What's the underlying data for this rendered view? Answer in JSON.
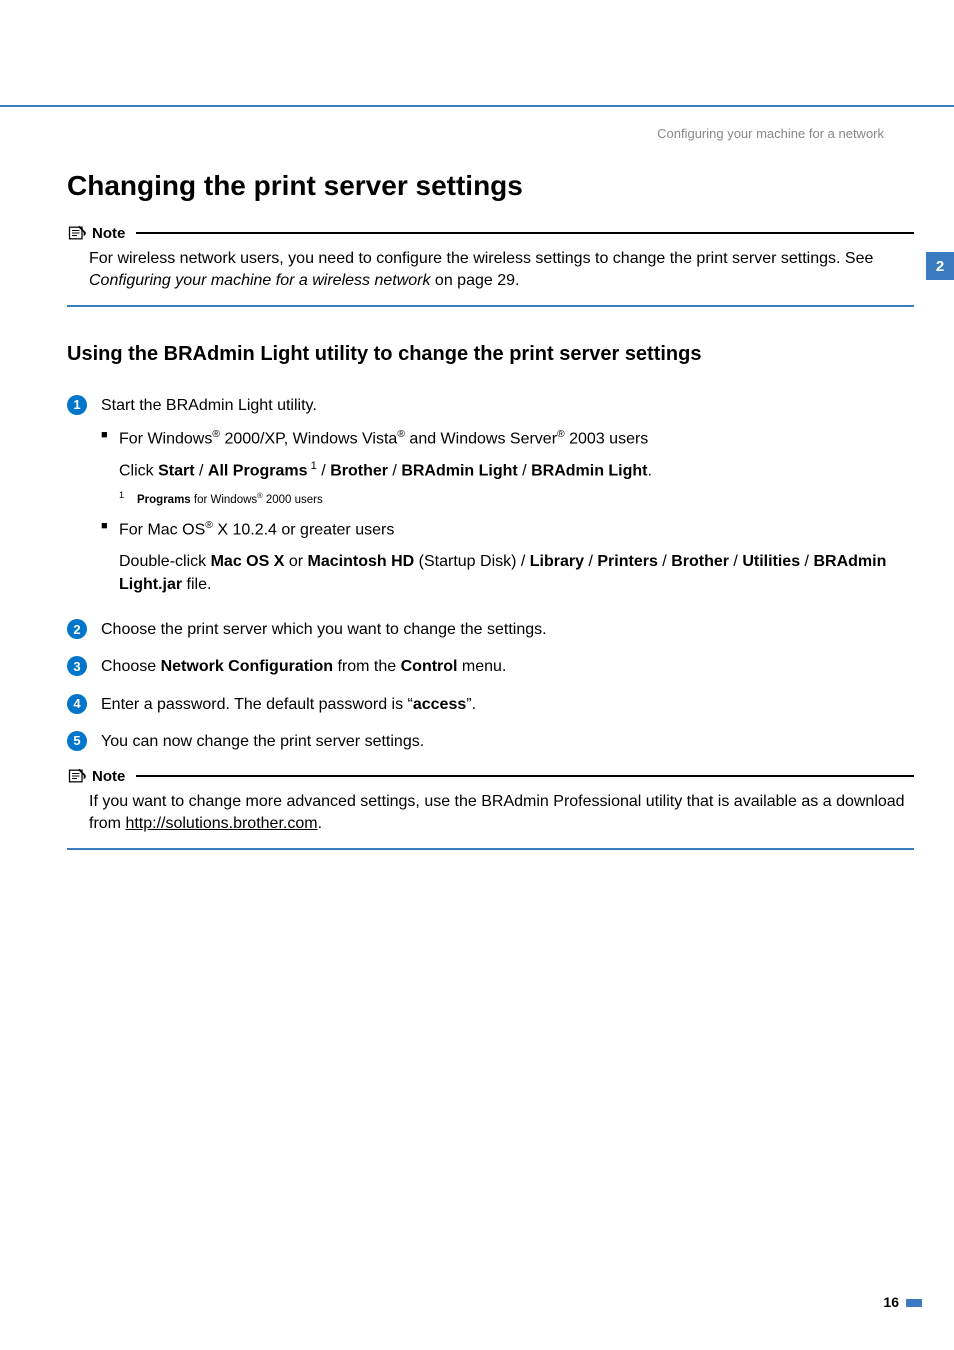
{
  "header": {
    "running_title": "Configuring your machine for a network",
    "chapter_tab": "2"
  },
  "h1": "Changing the print server settings",
  "note1": {
    "label": "Note",
    "body_pre": "For wireless network users, you need to configure the wireless settings to change the print server settings. See ",
    "body_italic": "Configuring your machine for a wireless network",
    "body_post": " on page 29."
  },
  "h2": "Using the BRAdmin Light utility to change the print server settings",
  "steps": {
    "s1": {
      "num": "1",
      "intro": "Start the BRAdmin Light utility.",
      "win": {
        "pre": "For Windows",
        "mid1": " 2000/XP, Windows Vista",
        "mid2": " and Windows Server",
        "post": " 2003 users",
        "click_pre": "Click ",
        "start": "Start",
        "sep": " / ",
        "all_programs": "All Programs",
        "fn_ref": " 1",
        "brother": "Brother",
        "bradmin1": "BRAdmin Light",
        "bradmin2": "BRAdmin Light",
        "period": "."
      },
      "footnote": {
        "num": "1",
        "bold": "Programs",
        "rest_pre": " for Windows",
        "rest_post": " 2000 users"
      },
      "mac": {
        "pre": "For Mac OS",
        "post": " X 10.2.4 or greater users",
        "dbl_pre": "Double-click ",
        "macosx": "Mac OS X",
        "or": " or ",
        "machd": "Macintosh HD",
        "startup": " (Startup Disk) / ",
        "library": "Library",
        "sep": " / ",
        "printers": "Printers",
        "brother": "Brother",
        "utilities": "Utilities",
        "jar": "BRAdmin Light.jar",
        "file": " file."
      }
    },
    "s2": {
      "num": "2",
      "text": "Choose the print server which you want to change the settings."
    },
    "s3": {
      "num": "3",
      "pre": "Choose ",
      "netconf": "Network Configuration",
      "mid": " from the ",
      "control": "Control",
      "post": " menu."
    },
    "s4": {
      "num": "4",
      "pre": "Enter a password. The default password is “",
      "pw": "access",
      "post": "”."
    },
    "s5": {
      "num": "5",
      "text": "You can now change the print server settings."
    }
  },
  "note2": {
    "label": "Note",
    "pre": "If you want to change more advanced settings, use the BRAdmin Professional utility that is available as a download from ",
    "link": "http://solutions.brother.com",
    "post": "."
  },
  "page_number": "16"
}
